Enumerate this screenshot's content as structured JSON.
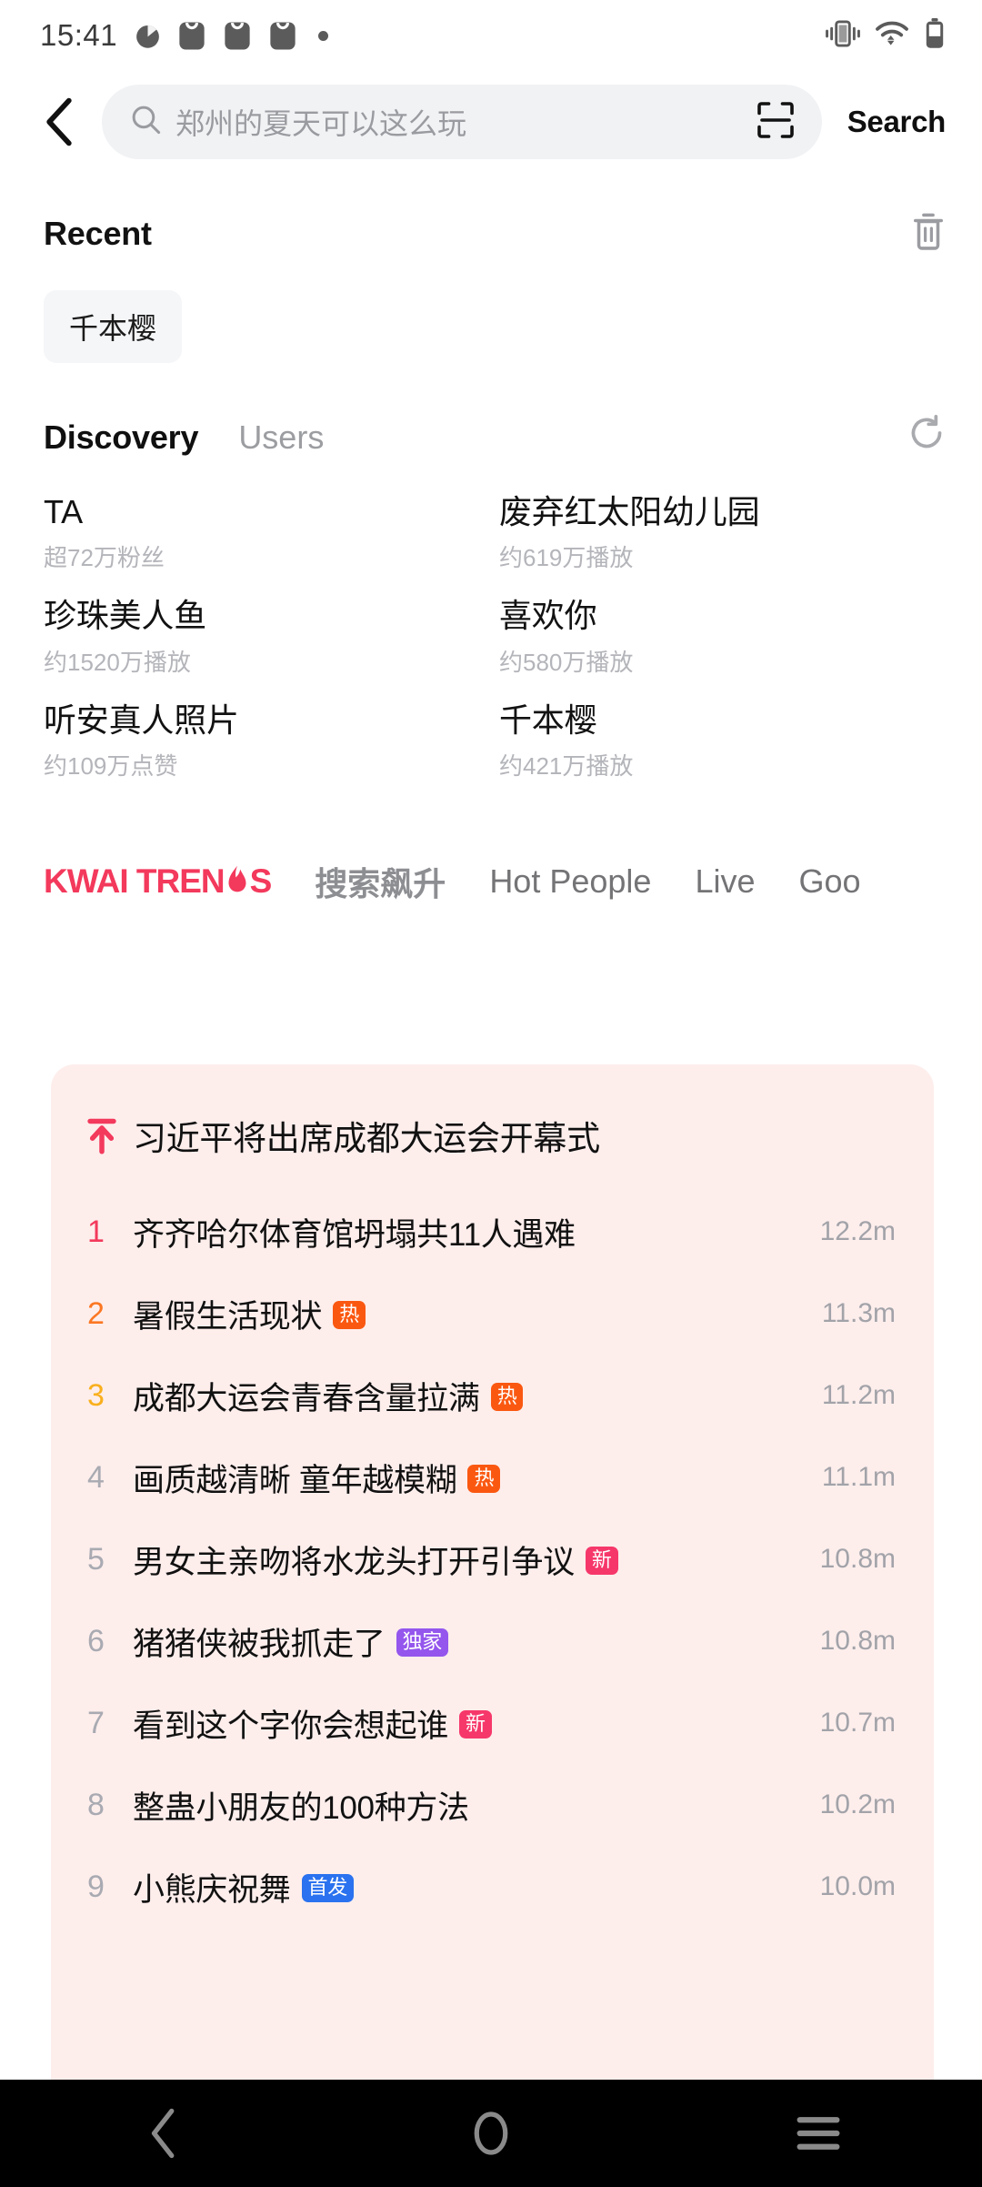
{
  "status_bar": {
    "time": "15:41",
    "icons": [
      "speedometer-icon",
      "app-notification-icon",
      "app-notification-icon",
      "app-notification-icon",
      "dot-icon"
    ],
    "right_icons": [
      "vibrate-icon",
      "wifi-icon",
      "battery-icon"
    ]
  },
  "header": {
    "back_label": "back-arrow",
    "search_placeholder": "郑州的夏天可以这么玩",
    "search_button": "Search",
    "scan_icon": "scan-icon"
  },
  "recent": {
    "title": "Recent",
    "clear_icon": "trash-icon",
    "chips": [
      "千本樱"
    ]
  },
  "discovery": {
    "tabs": [
      {
        "label": "Discovery",
        "active": true
      },
      {
        "label": "Users",
        "active": false
      }
    ],
    "refresh_icon": "refresh-icon",
    "items": [
      {
        "name": "TA",
        "meta": "超72万粉丝"
      },
      {
        "name": "废弃红太阳幼儿园",
        "meta": "约619万播放"
      },
      {
        "name": "珍珠美人鱼",
        "meta": "约1520万播放"
      },
      {
        "name": "喜欢你",
        "meta": "约580万播放"
      },
      {
        "name": "听安真人照片",
        "meta": "约109万点赞"
      },
      {
        "name": "千本樱",
        "meta": "约421万播放"
      }
    ]
  },
  "trend_tabs": [
    {
      "label": "KWAI TRENDS",
      "type": "logo",
      "active": true
    },
    {
      "label": "搜索飙升",
      "type": "text",
      "active": false
    },
    {
      "label": "Hot People",
      "type": "text",
      "active": false
    },
    {
      "label": "Live",
      "type": "text",
      "active": false
    },
    {
      "label": "Goo",
      "type": "text",
      "active": false
    }
  ],
  "trending_list": [
    {
      "rank": "",
      "rank_icon": "trending-top-arrow-icon",
      "title": "习近平将出席成都大运会开幕式",
      "badge": "",
      "badge_type": "",
      "count": ""
    },
    {
      "rank": "1",
      "title": "齐齐哈尔体育馆坍塌共11人遇难",
      "badge": "",
      "badge_type": "",
      "count": "12.2m"
    },
    {
      "rank": "2",
      "title": "暑假生活现状",
      "badge": "热",
      "badge_type": "hot",
      "count": "11.3m"
    },
    {
      "rank": "3",
      "title": "成都大运会青春含量拉满",
      "badge": "热",
      "badge_type": "hot",
      "count": "11.2m"
    },
    {
      "rank": "4",
      "title": "画质越清晰 童年越模糊",
      "badge": "热",
      "badge_type": "hot",
      "count": "11.1m"
    },
    {
      "rank": "5",
      "title": "男女主亲吻将水龙头打开引争议",
      "badge": "新",
      "badge_type": "new",
      "count": "10.8m"
    },
    {
      "rank": "6",
      "title": "猪猪侠被我抓走了",
      "badge": "独家",
      "badge_type": "excl",
      "count": "10.8m"
    },
    {
      "rank": "7",
      "title": "看到这个字你会想起谁",
      "badge": "新",
      "badge_type": "new",
      "count": "10.7m"
    },
    {
      "rank": "8",
      "title": "整蛊小朋友的100种方法",
      "badge": "",
      "badge_type": "",
      "count": "10.2m"
    },
    {
      "rank": "9",
      "title": "小熊庆祝舞",
      "badge": "首发",
      "badge_type": "first",
      "count": "10.0m"
    }
  ],
  "nav_bar": {
    "back": "back-nav-icon",
    "home": "home-nav-icon",
    "recents": "recents-nav-icon"
  },
  "colors": {
    "brand_pink": "#f3395c",
    "hot_orange": "#fa5811",
    "new_pink": "#f6376a",
    "exclusive_purple": "#9456ed",
    "first_blue": "#2a72ef",
    "card_bg": "#fdeeec"
  }
}
